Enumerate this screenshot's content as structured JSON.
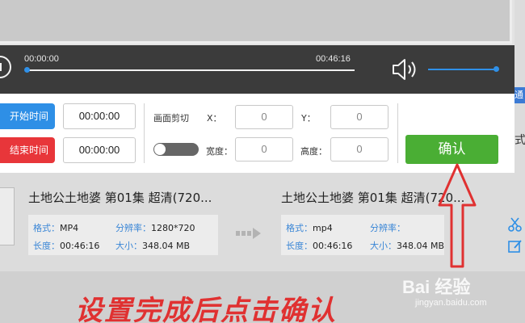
{
  "player": {
    "current_time": "00:00:00",
    "total_time": "00:46:16",
    "progress": 0,
    "volume": 1
  },
  "side": {
    "tag": "通",
    "text": "式"
  },
  "trim": {
    "start_button": "开始时间",
    "end_button": "结束时间",
    "start_value": "00:00:00",
    "end_value": "00:00:00"
  },
  "crop": {
    "label": "画面剪切",
    "x_label": "X：",
    "y_label": "Y：",
    "width_label": "宽度：",
    "height_label": "高度：",
    "x_value": "0",
    "y_value": "0",
    "width_value": "0",
    "height_value": "0",
    "toggle_on": false
  },
  "confirm_label": "确认",
  "source_file": {
    "title": "土地公土地婆 第01集 超清(720...",
    "format_key": "格式：",
    "format_value": "MP4",
    "resolution_key": "分辨率：",
    "resolution_value": "1280*720",
    "duration_key": "长度：",
    "duration_value": "00:46:16",
    "size_key": "大小：",
    "size_value": "348.04 MB"
  },
  "output_file": {
    "title": "土地公土地婆 第01集 超清(720...",
    "format_key": "格式：",
    "format_value": "mp4",
    "resolution_key": "分辨率：",
    "resolution_value": "",
    "duration_key": "长度：",
    "duration_value": "00:46:16",
    "size_key": "大小：",
    "size_value": "348.04 MB"
  },
  "annotation": {
    "caption": "设置完成后点击确认",
    "color": "#e03131"
  },
  "watermark": {
    "brand": "Bai 经验",
    "url": "jingyan.baidu.com"
  },
  "colors": {
    "blue": "#2e8fe6",
    "red": "#e8363a",
    "green": "#4aae34",
    "player_bg": "#3b3b3b"
  }
}
